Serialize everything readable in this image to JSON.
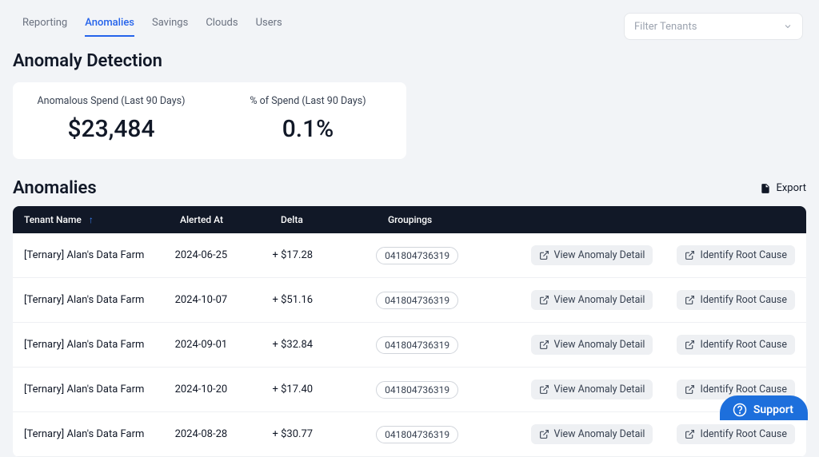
{
  "nav": {
    "tabs": [
      "Reporting",
      "Anomalies",
      "Savings",
      "Clouds",
      "Users"
    ],
    "active_index": 1,
    "filter_placeholder": "Filter Tenants"
  },
  "page": {
    "title": "Anomaly Detection",
    "metrics": [
      {
        "label": "Anomalous Spend (Last 90 Days)",
        "value": "$23,484"
      },
      {
        "label": "% of Spend (Last 90 Days)",
        "value": "0.1%"
      }
    ]
  },
  "section": {
    "title": "Anomalies",
    "export_label": "Export"
  },
  "table": {
    "columns": {
      "tenant": "Tenant Name",
      "alerted": "Alerted At",
      "delta": "Delta",
      "groupings": "Groupings"
    },
    "sort_column": "tenant",
    "sort_direction": "asc",
    "action_labels": {
      "view": "View Anomaly Detail",
      "root": "Identify Root Cause"
    },
    "rows": [
      {
        "tenant": "[Ternary] Alan's Data Farm",
        "alerted": "2024-06-25",
        "delta": "+ $17.28",
        "grouping": "041804736319"
      },
      {
        "tenant": "[Ternary] Alan's Data Farm",
        "alerted": "2024-10-07",
        "delta": "+ $51.16",
        "grouping": "041804736319"
      },
      {
        "tenant": "[Ternary] Alan's Data Farm",
        "alerted": "2024-09-01",
        "delta": "+ $32.84",
        "grouping": "041804736319"
      },
      {
        "tenant": "[Ternary] Alan's Data Farm",
        "alerted": "2024-10-20",
        "delta": "+ $17.40",
        "grouping": "041804736319"
      },
      {
        "tenant": "[Ternary] Alan's Data Farm",
        "alerted": "2024-08-28",
        "delta": "+ $30.77",
        "grouping": "041804736319"
      }
    ]
  },
  "support": {
    "label": "Support"
  }
}
